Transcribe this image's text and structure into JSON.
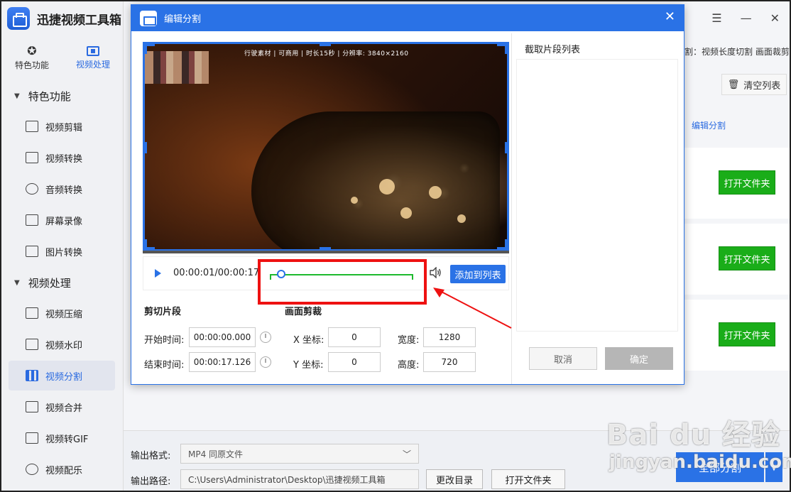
{
  "app": {
    "title": "迅捷视频工具箱"
  },
  "top_tabs": [
    {
      "label": "特色功能"
    },
    {
      "label": "视频处理"
    }
  ],
  "sidebar": {
    "sections": [
      {
        "label": "特色功能"
      },
      {
        "label": "视频处理"
      }
    ],
    "items": [
      {
        "label": "视频剪辑"
      },
      {
        "label": "视频转换"
      },
      {
        "label": "音频转换"
      },
      {
        "label": "屏幕录像"
      },
      {
        "label": "图片转换"
      },
      {
        "label": "视频压缩"
      },
      {
        "label": "视频水印"
      },
      {
        "label": "视频分割"
      },
      {
        "label": "视频合并"
      },
      {
        "label": "视频转GIF"
      },
      {
        "label": "视频配乐"
      }
    ]
  },
  "main": {
    "breadcrumb": "割：视频长度切割 画面裁剪",
    "clear_list": "清空列表",
    "edit_split_link": "编辑分割",
    "open_folder": "打开文件夹",
    "output_format_label": "输出格式:",
    "output_format_value": "MP4  同原文件",
    "output_path_label": "输出路径:",
    "output_path_value": "C:\\Users\\Administrator\\Desktop\\迅捷视频工具箱",
    "change_dir": "更改目录",
    "open_folder_bottom": "打开文件夹",
    "split_all": "全部分割"
  },
  "modal": {
    "title": "编辑分割",
    "video_info": "行驶素材  |  可商用  |  时长15秒  |  分辨率: 3840×2160",
    "time_display": "00:00:01/00:00:17",
    "trim_position": 0.08,
    "add_to_list": "添加到列表",
    "clip_section_title": "剪切片段",
    "start_label": "开始时间:",
    "start_value": "00:00:00.000",
    "end_label": "结束时间:",
    "end_value": "00:00:17.126",
    "crop_section_title": "画面剪裁",
    "x_label": "X 坐标:",
    "x_value": "0",
    "y_label": "Y 坐标:",
    "y_value": "0",
    "width_label": "宽度:",
    "width_value": "1280",
    "height_label": "高度:",
    "height_value": "720",
    "list_title": "截取片段列表",
    "cancel": "取消",
    "confirm": "确定"
  },
  "watermark": {
    "main": "Bai du 经验",
    "sub": "jingyan.baidu.com"
  },
  "colors": {
    "accent": "#2a72e6",
    "green": "#1aad19",
    "highlight_red": "#e11111"
  }
}
